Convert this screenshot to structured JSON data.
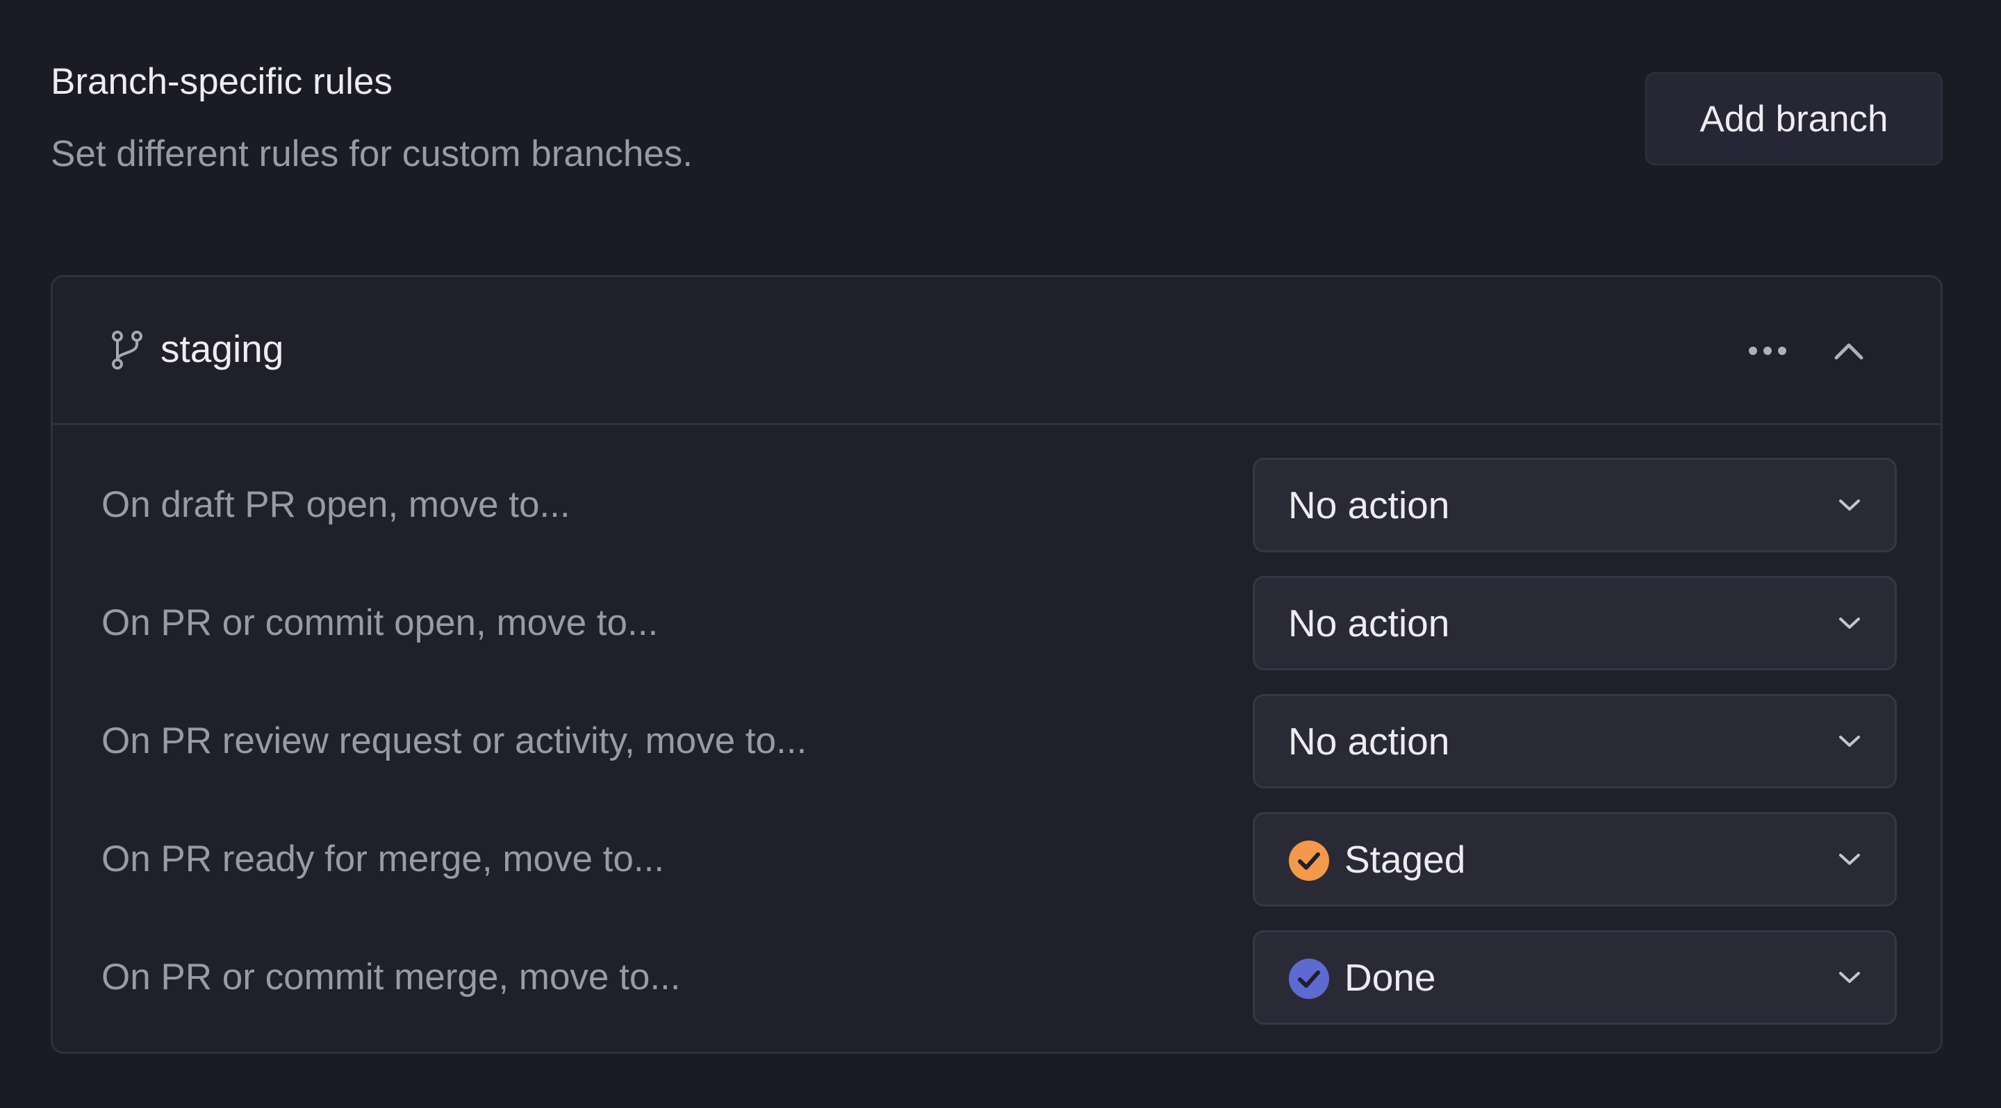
{
  "section": {
    "title": "Branch-specific rules",
    "description": "Set different rules for custom branches.",
    "add_branch_label": "Add branch"
  },
  "branch": {
    "name": "staging",
    "icons": {
      "branch": "git-branch-icon",
      "more": "more-horizontal-icon",
      "collapse": "chevron-up-icon"
    },
    "rules": [
      {
        "label": "On draft PR open, move to...",
        "value": "No action",
        "status_icon": null
      },
      {
        "label": "On PR or commit open, move to...",
        "value": "No action",
        "status_icon": null
      },
      {
        "label": "On PR review request or activity, move to...",
        "value": "No action",
        "status_icon": null
      },
      {
        "label": "On PR ready for merge, move to...",
        "value": "Staged",
        "status_icon": "orange-check-circle-icon"
      },
      {
        "label": "On PR or commit merge, move to...",
        "value": "Done",
        "status_icon": "blue-check-circle-icon"
      }
    ]
  },
  "colors": {
    "background": "#1b1b25",
    "card": "#20202b",
    "select": "#2a2a37",
    "staged": "#f2994a",
    "done": "#5e6ad2"
  }
}
